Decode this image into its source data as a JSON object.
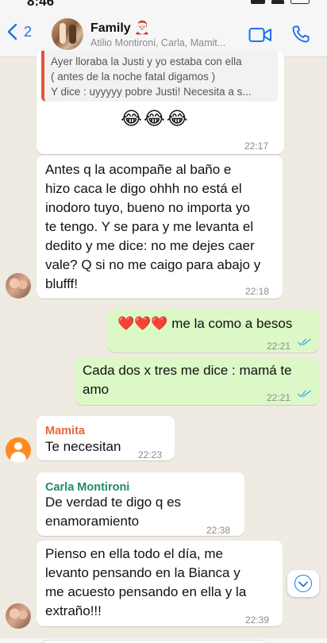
{
  "status": {
    "time": "8:46"
  },
  "header": {
    "back_count": "2",
    "title": "Family 🎅🏻",
    "subtitle": "Atilio Montironi, Carla, Mamit..."
  },
  "messages": {
    "quoted": {
      "lines": [
        "Ayer lloraba la Justi y yo estaba con ella",
        "( antes de la noche fatal digamos )",
        "Y dice : uyyyyy pobre Justi! Necesita a s..."
      ],
      "emojis": "😂😂😂",
      "time": "22:17"
    },
    "m1": {
      "lines": [
        "Antes q la acompañe al baño e",
        "hizo caca le digo ohhh no está el",
        "inodoro tuyo, bueno no importa yo",
        "te tengo. Y se para y me levanta el",
        "dedito y me dice: no me dejes caer",
        "vale? Q si no me caigo para abajo y",
        "blufff!"
      ],
      "time": "22:18"
    },
    "m2": {
      "text": "❤️❤️❤️  me la como a besos",
      "time": "22:21"
    },
    "m3": {
      "lines": [
        "Cada dos  x tres me dice : mamá te",
        "amo"
      ],
      "time": "22:21"
    },
    "m4": {
      "sender": "Mamita",
      "sender_color": "#e8663d",
      "text": "Te necesitan",
      "time": "22:23"
    },
    "m5": {
      "sender": "Carla Montironi",
      "sender_color": "#1f8a6f",
      "lines": [
        "De verdad te digo q es",
        "enamoramiento"
      ],
      "time": "22:38"
    },
    "m6": {
      "lines": [
        "Pienso en ella todo el día, me",
        "levanto pensando en la Bianca y",
        "me acuesto pensando en ella y la",
        "extraño!!!"
      ],
      "time": "22:39"
    }
  },
  "colors": {
    "accent": "#1a73e8",
    "outgoing": "#dcf8c6",
    "incoming": "#ffffff",
    "read_ticks": "#4fb6ec"
  }
}
